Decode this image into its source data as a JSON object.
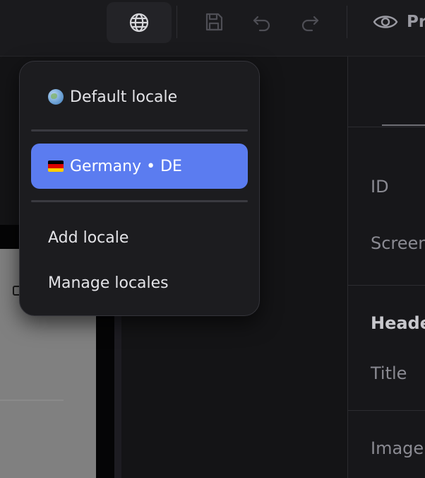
{
  "toolbar": {
    "preview_label": "Pr"
  },
  "locale_menu": {
    "default_item": {
      "icon": "globe-emoji-icon",
      "label": "Default locale"
    },
    "locales": [
      {
        "flag": "flag-germany-icon",
        "label": "Germany • DE",
        "selected": true
      }
    ],
    "actions": [
      {
        "label": "Add locale"
      },
      {
        "label": "Manage locales"
      }
    ]
  },
  "panel": {
    "fields": [
      {
        "label": "ID"
      },
      {
        "label": "Screen"
      }
    ],
    "section": {
      "heading": "Header",
      "fields": [
        {
          "label": "Title"
        },
        {
          "label": "Image"
        }
      ]
    }
  },
  "colors": {
    "accent": "#5b7cf0",
    "flag_black": "#000000",
    "flag_red": "#dd0000",
    "flag_gold": "#ffce00"
  }
}
